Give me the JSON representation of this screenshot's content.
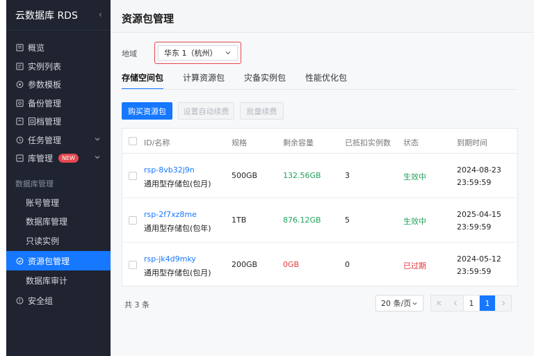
{
  "sidebar": {
    "title": "云数据库 RDS",
    "collapse_glyph": "‹",
    "items": [
      {
        "label": "概览",
        "icon": "overview-icon"
      },
      {
        "label": "实例列表",
        "icon": "list-icon"
      },
      {
        "label": "参数模板",
        "icon": "template-icon"
      },
      {
        "label": "备份管理",
        "icon": "backup-icon"
      },
      {
        "label": "回档管理",
        "icon": "rollback-icon"
      },
      {
        "label": "任务管理",
        "icon": "task-icon"
      },
      {
        "label": "库管理",
        "icon": "database-icon",
        "badge": "NEW"
      }
    ],
    "group_label": "数据库管理",
    "sub_items": [
      "账号管理",
      "数据库管理",
      "只读实例"
    ],
    "active_item": "资源包管理",
    "after_items": [
      "数据库审计"
    ],
    "security_item": "安全组"
  },
  "header": {
    "title": "资源包管理"
  },
  "region": {
    "label": "地域",
    "value": "华东 1（杭州）"
  },
  "tabs": [
    "存储空间包",
    "计算资源包",
    "灾备实例包",
    "性能优化包"
  ],
  "toolbar": {
    "buy": "购买资源包",
    "auto_renew": "设置自动续费",
    "batch_renew": "批量续费"
  },
  "table": {
    "headers": [
      "ID/名称",
      "规格",
      "剩余容量",
      "已抵扣实例数",
      "状态",
      "到期时间"
    ],
    "rows": [
      {
        "id": "rsp-8vb32j9n",
        "name": "通用型存储包(包月)",
        "spec": "500GB",
        "remain": "132.56GB",
        "count": "3",
        "status": "生效中",
        "date": "2024-08-23",
        "time": "23:59:59"
      },
      {
        "id": "rsp-2f7xz8me",
        "name": "通用型存储包(包年)",
        "spec": "1TB",
        "remain": "876.12GB",
        "count": "5",
        "status": "生效中",
        "date": "2025-04-15",
        "time": "23:59:59"
      },
      {
        "id": "rsp-jk4d9mky",
        "name": "通用型存储包(包月)",
        "spec": "200GB",
        "remain": "0GB",
        "count": "0",
        "status": "已过期",
        "date": "2024-05-12",
        "time": "23:59:59"
      }
    ]
  },
  "pagination": {
    "total": "共 3 条",
    "page_size": "20 条/页",
    "pages": [
      "1",
      "1"
    ]
  },
  "colors": {
    "accent": "#1677ff",
    "sidebar_bg": "#1f2430",
    "active_green": "#1fa15a",
    "expired_red": "#e5363b"
  }
}
